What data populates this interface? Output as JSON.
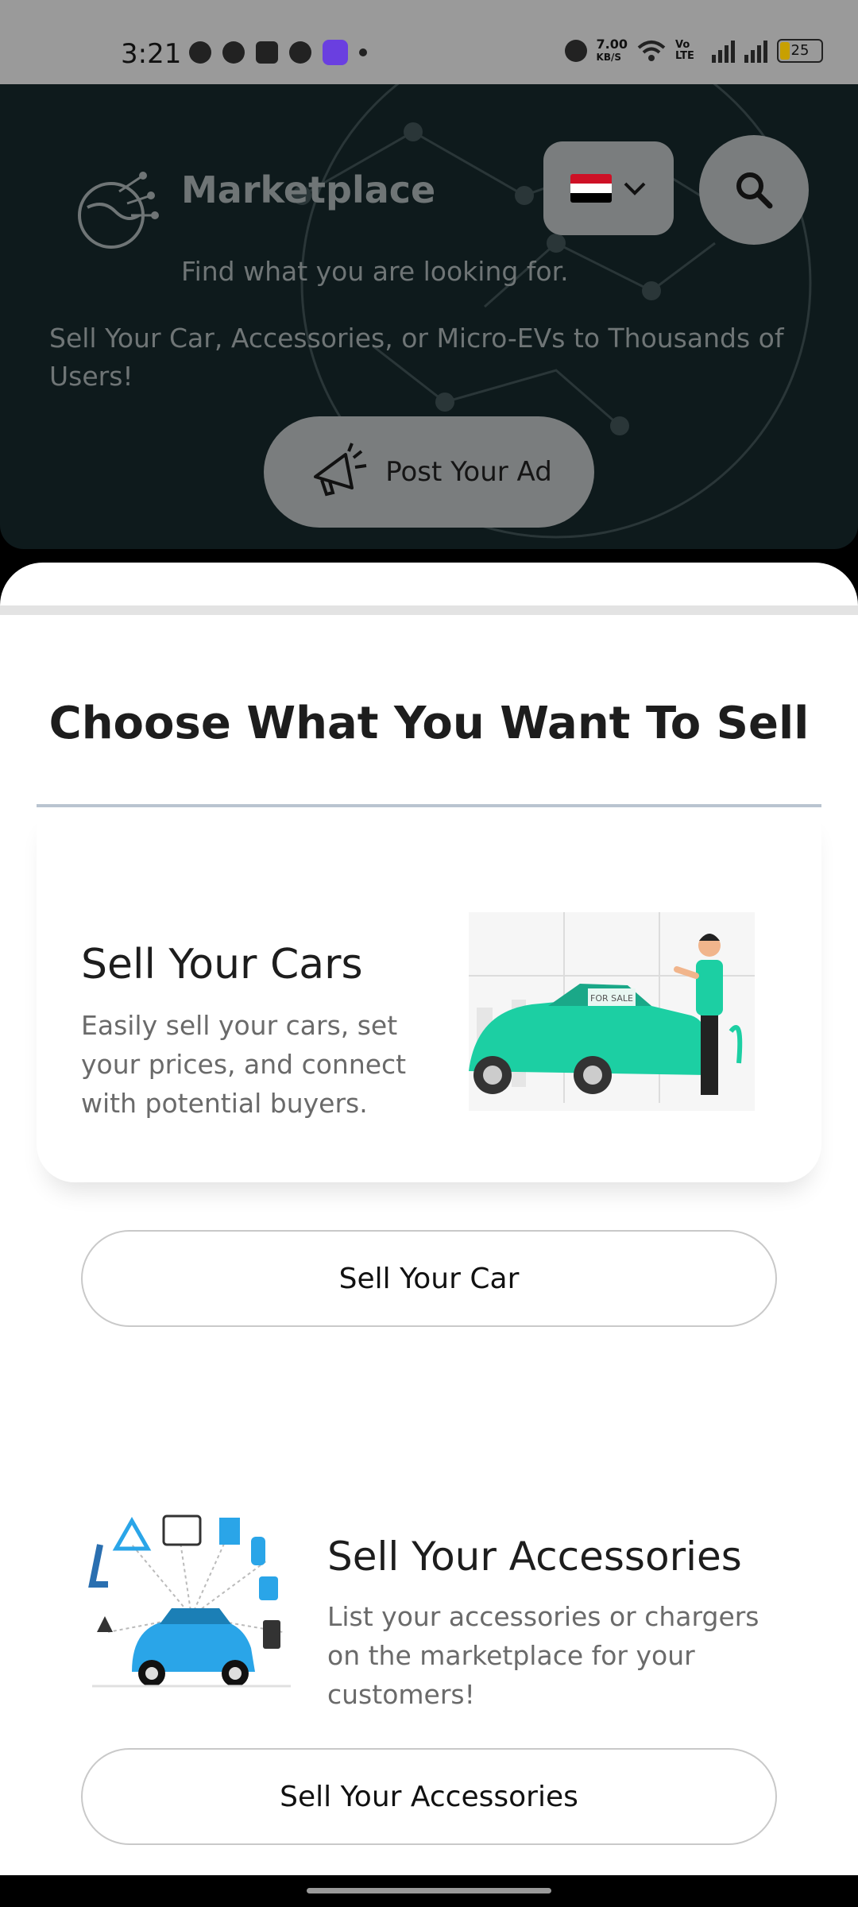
{
  "status_bar": {
    "time": "3:21",
    "net_speed": "7.00",
    "net_unit": "KB/S",
    "volte": "Vo LTE",
    "battery": "25",
    "icons": [
      "whatsapp-icon",
      "facebook-icon",
      "youtube-icon",
      "cloud-download-icon",
      "game-icon",
      "alarm-icon",
      "wifi-icon",
      "signal-icon",
      "battery-icon"
    ]
  },
  "header": {
    "title": "Marketplace",
    "subtitle": "Find what you are looking for.",
    "description": "Sell Your Car, Accessories, or Micro-EVs to Thousands of Users!",
    "post_ad_label": "Post Your Ad",
    "flag_colors": [
      "#ce1126",
      "#ffffff",
      "#000000"
    ]
  },
  "sheet": {
    "title": "Choose What You Want To Sell",
    "cars": {
      "title": "Sell Your Cars",
      "description": "Easily sell your cars, set your prices, and connect with potential buyers.",
      "button": "Sell Your Car",
      "sign_text": "FOR SALE"
    },
    "accessories": {
      "title": "Sell Your Accessories",
      "description": "List your accessories or chargers on the marketplace for your customers!",
      "button": "Sell Your Accessories"
    }
  },
  "colors": {
    "hero_bg": "#0e1a1c",
    "accent_car": "#1ccfa3",
    "accent_acc": "#2aa5e8"
  }
}
